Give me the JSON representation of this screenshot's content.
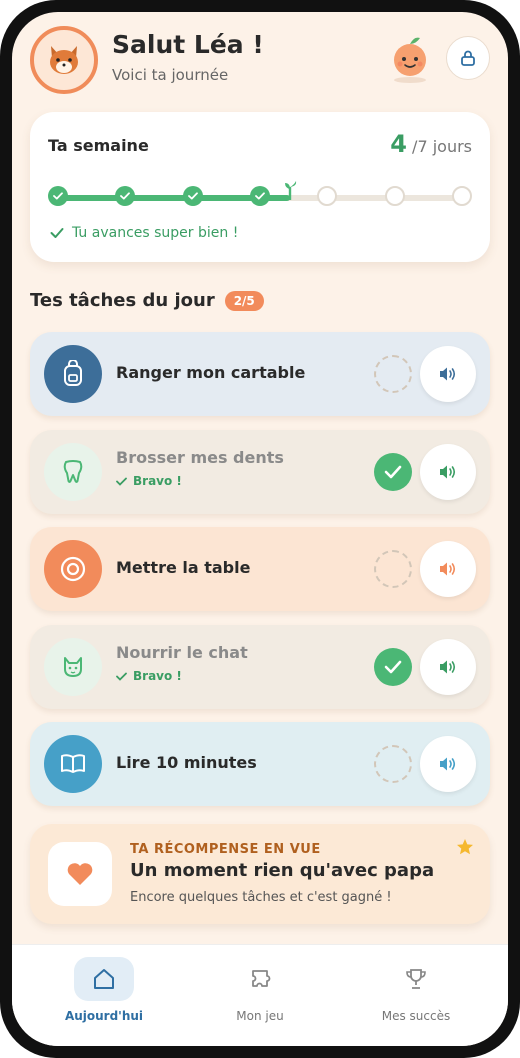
{
  "header": {
    "greeting": "Salut Léa !",
    "subtitle": "Voici ta journée",
    "icons": {
      "avatar": "fox-avatar",
      "mascot": "peach-mascot",
      "lock": "lock-icon"
    }
  },
  "week": {
    "title": "Ta semaine",
    "count_value": "4",
    "count_suffix": "/7 jours",
    "days_done": 4,
    "days_total": 7,
    "message": "Tu avances super bien !"
  },
  "tasks_section": {
    "title": "Tes tâches du jour",
    "badge": "2/5"
  },
  "tasks": [
    {
      "label": "Ranger mon cartable",
      "done": false,
      "icon": "backpack-icon",
      "color": "#3d6e99",
      "bg": "#e4ebf2"
    },
    {
      "label": "Brosser mes dents",
      "done": true,
      "status": "Bravo !",
      "icon": "tooth-icon",
      "color": "#4bb775",
      "bg": "#f2ebe2"
    },
    {
      "label": "Mettre la table",
      "done": false,
      "icon": "plate-icon",
      "color": "#f28b5b",
      "bg": "#fce5d3"
    },
    {
      "label": "Nourrir le chat",
      "done": true,
      "status": "Bravo !",
      "icon": "cat-icon",
      "color": "#4bb775",
      "bg": "#f2ebe2"
    },
    {
      "label": "Lire 10 minutes",
      "done": false,
      "icon": "book-icon",
      "color": "#46a0c8",
      "bg": "#e0eef2"
    }
  ],
  "reward": {
    "kicker": "TA RÉCOMPENSE EN VUE",
    "title": "Un moment rien qu'avec papa",
    "subtitle": "Encore quelques tâches et c'est gagné !",
    "icon": "heart-icon"
  },
  "nav": [
    {
      "label": "Aujourd'hui",
      "icon": "home-icon",
      "active": true
    },
    {
      "label": "Mon jeu",
      "icon": "puzzle-icon",
      "active": false
    },
    {
      "label": "Mes succès",
      "icon": "trophy-icon",
      "active": false
    }
  ]
}
